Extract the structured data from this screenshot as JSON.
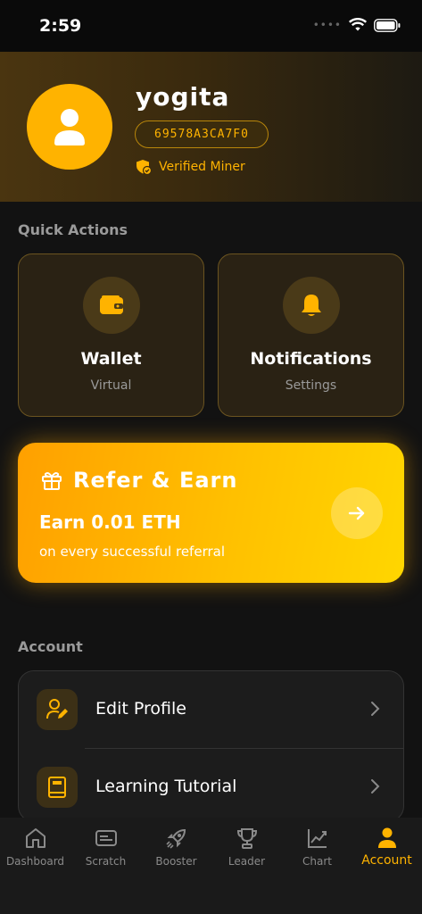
{
  "status": {
    "time": "2:59"
  },
  "profile": {
    "username": "yogita",
    "miner_id": "69578A3CA7F0",
    "verified_label": "Verified Miner"
  },
  "quick_actions": {
    "title": "Quick Actions",
    "items": [
      {
        "title": "Wallet",
        "subtitle": "Virtual",
        "icon": "wallet-icon"
      },
      {
        "title": "Notifications",
        "subtitle": "Settings",
        "icon": "bell-icon"
      }
    ]
  },
  "refer": {
    "title": "Refer & Earn",
    "amount": "Earn 0.01 ETH",
    "description": "on every successful referral"
  },
  "account": {
    "title": "Account",
    "items": [
      {
        "label": "Edit Profile",
        "icon": "edit-profile-icon"
      },
      {
        "label": "Learning Tutorial",
        "icon": "book-icon"
      }
    ]
  },
  "tabs": [
    {
      "label": "Dashboard",
      "icon": "home-icon"
    },
    {
      "label": "Scratch",
      "icon": "scratch-card-icon"
    },
    {
      "label": "Booster",
      "icon": "rocket-icon"
    },
    {
      "label": "Leader",
      "icon": "trophy-icon"
    },
    {
      "label": "Chart",
      "icon": "chart-icon"
    },
    {
      "label": "Account",
      "icon": "user-icon",
      "active": true
    }
  ],
  "colors": {
    "accent": "#ffb300",
    "background": "#121212"
  }
}
